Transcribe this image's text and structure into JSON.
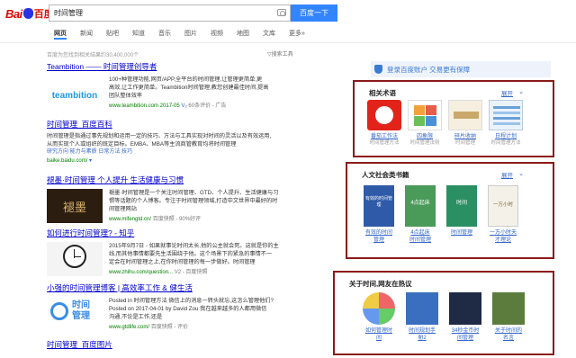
{
  "header": {
    "logo_text_1": "Bai",
    "logo_text_2": "百度",
    "search_value": "时间管理",
    "search_button": "百度一下"
  },
  "tabs": [
    "网页",
    "新闻",
    "贴吧",
    "知道",
    "音乐",
    "图片",
    "视频",
    "地图",
    "文库",
    "更多»"
  ],
  "search_tools": "搜索工具",
  "stats": "百度为您找到相关结果约30,400,000个",
  "results": [
    {
      "title": "Teambition —— 时间管理创导者",
      "lines": [
        "100+种管理功能,网页/APP,全平台的时间管理,让管理更简单,更",
        "高效,让工作更简单。Teambition时间管理,教您创建最佳时间,提高",
        "团队整体效率"
      ],
      "url": "www.teambition.com 2017-05",
      "meta": "60条评价 - 广告",
      "thumb_label": "teambition"
    },
    {
      "title": "时间管理_百度百科",
      "lines": [
        "时间管理是指通过事先规划和运用一定的技巧、方法与工具实现对时间的灵活以及有效运用,",
        "从而实现个人或组织的既定目标。EMBA、MBA等主流商管教育均将时间管理",
        "研究方向  能力与素质  日常方法  技巧"
      ],
      "url": "baike.baidu.com/"
    },
    {
      "title": "褪墨·时间管理 个人提升 生活健康与习惯",
      "lines": [
        "褪墨·时间管理是一个关注时间管理、GTD、个人提升、生活健康与习",
        "惯等话题的个人博客。专注于时间管理领域,打造中文世界中最好的时",
        "间管理网站"
      ],
      "url": "www.mifengtd.cn/",
      "meta": "百度快照 - 90%好评",
      "thumb_label": "褪墨"
    },
    {
      "title": "如何进行时间管理? - 知乎",
      "lines": [
        "2015年9月7日 - 如果就事论时间太长,他的公主就会死。这就是你的主",
        "线,而其他事情都要先生活围绕于他。这个场景下的紧急的事情不一",
        "定会在时间管理之上,在你时间管理的每一步做好。时间管理"
      ],
      "url": "www.zhihu.com/question...",
      "meta": "V2 - 百度快照"
    },
    {
      "title": "小强的时间管理博客 | 高效率工作 & 健生活",
      "lines": [
        "Posted in 时间管理方法 微信上的消息一转头就忘,这怎么管理他们?",
        "Posted on 2017-04-01 by David Zou 我在越来越多的人都用微信",
        "沟通,不论是工作,还是"
      ],
      "url": "www.gtdlife.com/",
      "meta": "百度快照 - 评价",
      "thumb_label_1": "时间",
      "thumb_label_2": "管理"
    },
    {
      "title": "时间管理_百度图片"
    }
  ],
  "right": {
    "login": "登录百度账户 交易更有保障",
    "expand": "展开",
    "box1": {
      "title": "相关术语",
      "items": [
        {
          "cap1": "番茄工作法",
          "cap2": "时间管理方法"
        },
        {
          "cap1": "四象限",
          "cap2": "时间管理法则"
        },
        {
          "cap1": "碎片收纳",
          "cap2": "时间管理"
        },
        {
          "cap1": "日程计划",
          "cap2": "时间管理方法"
        }
      ]
    },
    "box2": {
      "title": "人文社会类书籍",
      "items": [
        {
          "cap1": "有效的时间",
          "cap2": "管理",
          "book": "有效的时间管理"
        },
        {
          "cap1": "4点起床",
          "cap2": "时间管理",
          "book": "4点起床"
        },
        {
          "cap1": "时间管理",
          "cap2": "",
          "book": "时间"
        },
        {
          "cap1": "一万小时天",
          "cap2": "才理论",
          "book": "一万小时"
        }
      ]
    },
    "box3": {
      "title": "关于时间,网友在热议",
      "items": [
        {
          "cap1": "如何管理时",
          "cap2": "间"
        },
        {
          "cap1": "时间规划手",
          "cap2": "册2"
        },
        {
          "cap1": "34秒金币时",
          "cap2": "间管理"
        },
        {
          "cap1": "关于时间的",
          "cap2": "名言"
        }
      ]
    }
  }
}
